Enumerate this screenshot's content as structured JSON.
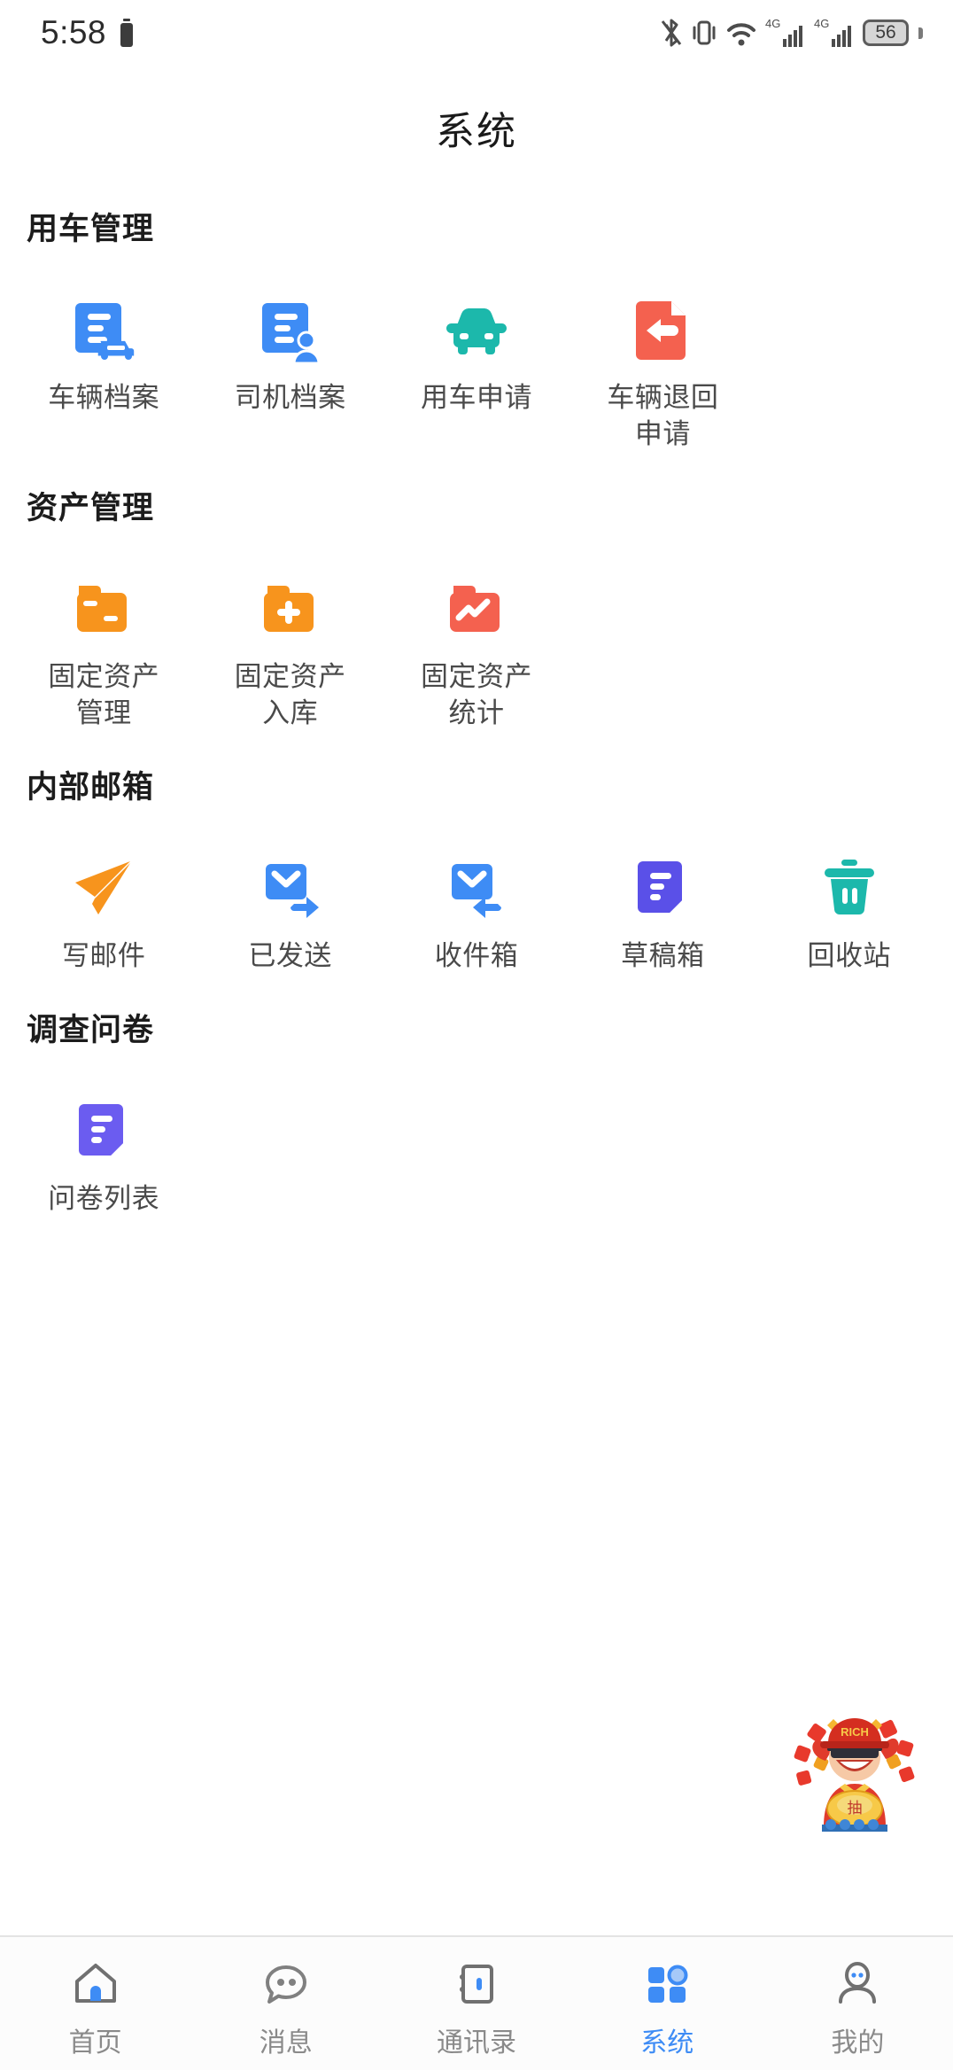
{
  "statusbar": {
    "time": "5:58",
    "battery_level": "56",
    "icons": [
      "battery-small-icon",
      "bluetooth-icon",
      "vibrate-icon",
      "wifi-icon",
      "signal-4g-1-icon",
      "signal-4g-2-icon",
      "battery-icon"
    ],
    "network_label_1": "4G",
    "network_label_2": "4G"
  },
  "header": {
    "title": "系统"
  },
  "sections": [
    {
      "title": "用车管理",
      "items": [
        {
          "label": "车辆档案",
          "icon": "vehicle-file-icon",
          "color": "#3e8cf5"
        },
        {
          "label": "司机档案",
          "icon": "driver-file-icon",
          "color": "#3e8cf5"
        },
        {
          "label": "用车申请",
          "icon": "car-icon",
          "color": "#1cb8ab"
        },
        {
          "label": "车辆退回申请",
          "icon": "vehicle-return-icon",
          "color": "#f4614f"
        }
      ]
    },
    {
      "title": "资产管理",
      "items": [
        {
          "label": "固定资产管理",
          "icon": "asset-folder-icon",
          "color": "#f7941d"
        },
        {
          "label": "固定资产入库",
          "icon": "asset-add-folder-icon",
          "color": "#f7941d"
        },
        {
          "label": "固定资产统计",
          "icon": "asset-stats-folder-icon",
          "color": "#f4614f"
        }
      ]
    },
    {
      "title": "内部邮箱",
      "items": [
        {
          "label": "写邮件",
          "icon": "paper-plane-icon",
          "color": "#f7941d"
        },
        {
          "label": "已发送",
          "icon": "mail-sent-icon",
          "color": "#3e8cf5"
        },
        {
          "label": "收件箱",
          "icon": "mail-inbox-icon",
          "color": "#3e8cf5"
        },
        {
          "label": "草稿箱",
          "icon": "draft-document-icon",
          "color": "#5a50e8"
        },
        {
          "label": "回收站",
          "icon": "trash-icon",
          "color": "#1cb8ab"
        }
      ]
    },
    {
      "title": "调查问卷",
      "items": [
        {
          "label": "问卷列表",
          "icon": "survey-document-icon",
          "color": "#6b5cf0"
        }
      ]
    }
  ],
  "mascot": {
    "name": "lucky-draw-mascot",
    "cap_text": "RICH",
    "ingot_text": "抽"
  },
  "tabbar": {
    "active_color": "#3e8cf5",
    "inactive_color": "#8a8a8a",
    "tabs": [
      {
        "label": "首页",
        "icon": "home-icon",
        "active": false
      },
      {
        "label": "消息",
        "icon": "message-icon",
        "active": false
      },
      {
        "label": "通讯录",
        "icon": "contacts-icon",
        "active": false
      },
      {
        "label": "系统",
        "icon": "grid-icon",
        "active": true
      },
      {
        "label": "我的",
        "icon": "profile-icon",
        "active": false
      }
    ]
  }
}
